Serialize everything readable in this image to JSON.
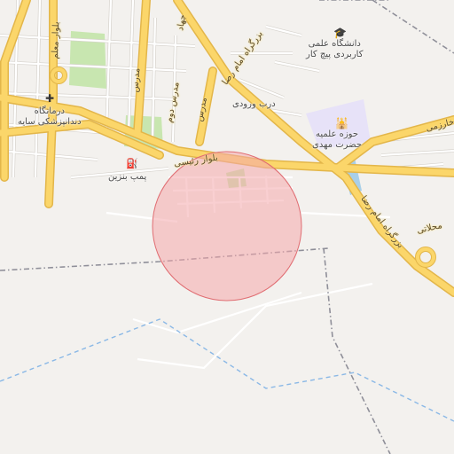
{
  "map": {
    "colors": {
      "background": "#f3f1ee",
      "major_road": "#fbd66a",
      "major_road_casing": "#e3b64a",
      "minor_road": "#ffffff",
      "minor_road_casing": "#d6d2cc",
      "park": "#c8e6b0",
      "campus": "#e7e2f8",
      "water": "#a8cfe8",
      "boundary": "#8f8f99",
      "waterway_dashed": "#8ab8e6",
      "circle_fill": "#f4a8ab",
      "circle_stroke": "#e06d72"
    },
    "labels": {
      "dental_clinic": "درمانگاه\nدندانپزشکی سایه",
      "gas_station": "پمپ بنزین",
      "university": "دانشگاه علمی\nکاربردی پیچ کار",
      "seminary": "حوزه علمیه\nحضرت مهدی",
      "entrance_gate": "درب ورودی",
      "boulevard_raisi": "بلوار رئیسی",
      "imam_reza_highway_top": "بزرگراه امام رضا",
      "imam_reza_highway_bottom": "بزرگراه امام رضا",
      "modares_1": "مدرس",
      "modares_2": "مدرس دوم",
      "modares_3": "مدرس",
      "boulevard_moallem": "بلوار معلم",
      "jihad": "جهاد",
      "mahallati": "محلاتی",
      "kharazmi": "خارزمی"
    },
    "icons": {
      "clinic": "plus-icon",
      "gas": "fuel-icon",
      "university": "graduation-cap-icon",
      "seminary": "mosque-icon"
    }
  }
}
